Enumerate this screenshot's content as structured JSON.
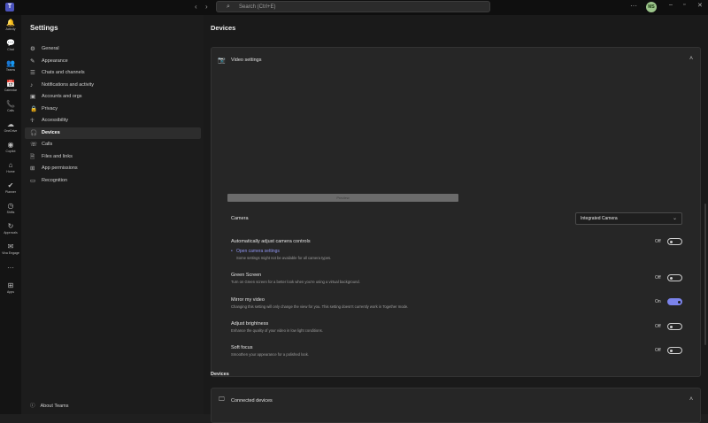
{
  "titlebar": {
    "search_placeholder": "Search (Ctrl+E)",
    "avatar_initials": "MS",
    "more": "···",
    "back": "‹",
    "forward": "›",
    "min": "–",
    "max": "▫",
    "close": "✕"
  },
  "rail": [
    {
      "label": "Activity",
      "icon": "🔔"
    },
    {
      "label": "Chat",
      "icon": "💬"
    },
    {
      "label": "Teams",
      "icon": "👥"
    },
    {
      "label": "Calendar",
      "icon": "📅"
    },
    {
      "label": "Calls",
      "icon": "📞"
    },
    {
      "label": "OneDrive",
      "icon": "☁"
    },
    {
      "label": "Copilot",
      "icon": "◉"
    },
    {
      "label": "Home",
      "icon": "⌂"
    },
    {
      "label": "Planner",
      "icon": "✔"
    },
    {
      "label": "Shifts",
      "icon": "◷"
    },
    {
      "label": "Approvals",
      "icon": "↻"
    },
    {
      "label": "Viva Engage",
      "icon": "✉"
    },
    {
      "label": "",
      "icon": "···"
    },
    {
      "label": "Apps",
      "icon": "⊞"
    }
  ],
  "sidebar": {
    "title": "Settings",
    "items": [
      {
        "label": "General",
        "icon": "⚙"
      },
      {
        "label": "Appearance",
        "icon": "✎"
      },
      {
        "label": "Chats and channels",
        "icon": "☰"
      },
      {
        "label": "Notifications and activity",
        "icon": "♪"
      },
      {
        "label": "Accounts and orgs",
        "icon": "▣"
      },
      {
        "label": "Privacy",
        "icon": "🔒"
      },
      {
        "label": "Accessibility",
        "icon": "☥"
      },
      {
        "label": "Devices",
        "icon": "🎧"
      },
      {
        "label": "Calls",
        "icon": "☏"
      },
      {
        "label": "Files and links",
        "icon": "🗎"
      },
      {
        "label": "App permissions",
        "icon": "⊞"
      },
      {
        "label": "Recognition",
        "icon": "▭"
      }
    ],
    "about": "About Teams",
    "about_icon": "ⓘ"
  },
  "main": {
    "title": "Devices",
    "video": {
      "header": "Video settings",
      "header_icon": "📷",
      "preview_label": "Preview",
      "camera_label": "Camera",
      "camera_value": "Integrated Camera",
      "auto_adjust": {
        "title": "Automatically adjust camera controls",
        "state": "Off"
      },
      "open_camera_settings": "Open camera settings",
      "open_camera_note": "Some settings might not be available for all camera types.",
      "green_screen": {
        "title": "Green Screen",
        "desc": "Turn on Green screen for a better look when you're using a virtual background.",
        "state": "Off"
      },
      "mirror": {
        "title": "Mirror my video",
        "desc": "Changing this setting will only change the view for you. This setting doesn't currently work in Together mode.",
        "state": "On"
      },
      "brightness": {
        "title": "Adjust brightness",
        "desc": "Enhance the quality of your video in low light conditions.",
        "state": "Off"
      },
      "soft_focus": {
        "title": "Soft focus",
        "desc": "Smoothen your appearance for a polished look.",
        "state": "Off"
      }
    },
    "devices_section": "Devices",
    "connected": {
      "header": "Connected devices",
      "icon": "🖵"
    }
  },
  "colors": {
    "accent": "#7b83eb",
    "background": "#1a1a1a",
    "card": "#262626"
  }
}
